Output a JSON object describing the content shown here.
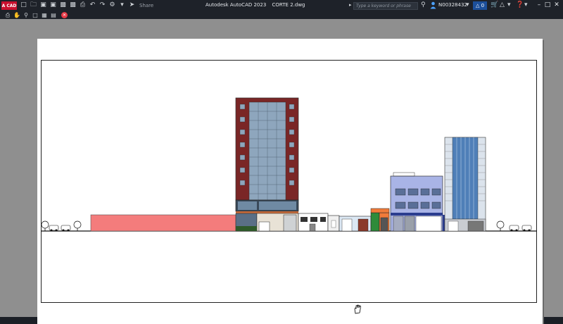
{
  "titlebar": {
    "app_badge": "A CAD",
    "app_name": "Autodesk AutoCAD 2023",
    "file_name": "CORTE 2.dwg",
    "share_label": "Share",
    "search_placeholder": "Type a keyword or phrase",
    "user_name": "N00328432",
    "alert_count": "0"
  },
  "colors": {
    "titlebar_bg": "#1e2229",
    "canvas_gray": "#8f8f8f",
    "tower_brick": "#7a2626",
    "glass": "#8ea6bd",
    "salmon_block": "#f47c7c",
    "lavender_building": "#a9b4e6",
    "blue_tower_glass": "#4f7fb8"
  }
}
